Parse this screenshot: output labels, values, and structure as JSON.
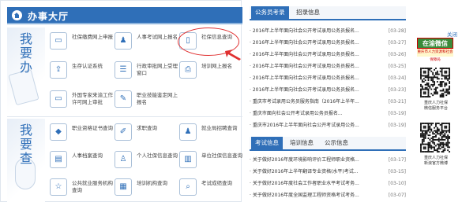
{
  "hall": {
    "title": "办事大厅",
    "doing_label": "我要办",
    "query_label": "我要查",
    "doing_items": [
      {
        "label": "社保缴费网上申报",
        "icon": "monitor-icon",
        "glyph": "▭"
      },
      {
        "label": "人事考试网上报名",
        "icon": "person-icon",
        "glyph": "♟"
      },
      {
        "label": "社保信息查询",
        "icon": "phone-icon",
        "glyph": "▯"
      },
      {
        "label": "生存认证系统",
        "icon": "upload-icon",
        "glyph": "⇪"
      },
      {
        "label": "行政审批网上受理窗口",
        "icon": "document-icon",
        "glyph": "☰"
      },
      {
        "label": "培训网上报名",
        "icon": "printer-icon",
        "glyph": "⎙"
      },
      {
        "label": "外国专家来渝工作许可网上审批",
        "icon": "screen-icon",
        "glyph": "▭"
      },
      {
        "label": "职业技能鉴定网上报名",
        "icon": "pencil-icon",
        "glyph": "✎"
      }
    ],
    "query_items": [
      {
        "label": "职业资格证书查询",
        "icon": "tag-icon",
        "glyph": "◆"
      },
      {
        "label": "求职查询",
        "icon": "edit-icon",
        "glyph": "✐"
      },
      {
        "label": "就业局招聘查询",
        "icon": "people-icon",
        "glyph": "♟"
      },
      {
        "label": "人事档案查询",
        "icon": "inbox-icon",
        "glyph": "▤"
      },
      {
        "label": "个人社保信息查询",
        "icon": "person-icon",
        "glyph": "♙"
      },
      {
        "label": "单位社保信息查询",
        "icon": "building-icon",
        "glyph": "▥"
      },
      {
        "label": "公共就业服务机构查询",
        "icon": "star-icon",
        "glyph": "☆"
      },
      {
        "label": "培训机构查询",
        "icon": "chart-icon",
        "glyph": "▦"
      },
      {
        "label": "考试成绩查询",
        "icon": "search-icon",
        "glyph": "⌕"
      }
    ]
  },
  "news_top": {
    "tabs": [
      "公务员考录",
      "招录信息"
    ],
    "items": [
      {
        "title": "· 2016年上半年面向社会公开考试录用公务员报名...",
        "date": "[03-28]"
      },
      {
        "title": "· 2016年上半年面向社会公开考试录用公务员报名...",
        "date": "[03-27]"
      },
      {
        "title": "· 2016年上半年面向社会公开考试录用公务员报名...",
        "date": "[03-26]"
      },
      {
        "title": "· 2016年上半年面向社会公开考试录用公务员报名...",
        "date": "[03-25]"
      },
      {
        "title": "· 2016年上半年面向社会公开考试录用公务员报名...",
        "date": "[03-24]"
      },
      {
        "title": "· 2016年上半年面向社会公开考试录用公务员报名...",
        "date": "[03-23]"
      },
      {
        "title": "· 重庆市考试录用公务员服务指南（2016年上半年...",
        "date": "[03-21]"
      },
      {
        "title": "· 重庆市面向社会公开考试录用公务员报名...",
        "date": "[03-19]"
      },
      {
        "title": "· 重庆市2016年上半年面向社会公开考试录用公务...",
        "date": "[03-19]"
      }
    ]
  },
  "news_bottom": {
    "tabs": [
      "考试信息",
      "培训信息",
      "公示信息"
    ],
    "items": [
      {
        "title": "· 关于做好2016年度环境影响评价工程师职业资格...",
        "date": "[03-17]"
      },
      {
        "title": "· 关于做好2016年上半年翻译专业资格(水平)考试...",
        "date": "[03-15]"
      },
      {
        "title": "· 关于做好2016年度社会工作者职业水平考试考务...",
        "date": "[03-10]"
      },
      {
        "title": "· 关于做好2016年度全国监理工程师资格考试考务...",
        "date": "[03-07]"
      }
    ]
  },
  "side": {
    "close": "关闭",
    "wei_badge": "在渝微信",
    "wei_sub": "重庆市人力资源和社会保障局",
    "qr1_caption": "重庆人力社保\n微信服务平台",
    "qr2_caption": "重庆人力社保\n新浪官方微博"
  },
  "colors": {
    "brand": "#2f6fb8",
    "highlight": "#e03030"
  }
}
